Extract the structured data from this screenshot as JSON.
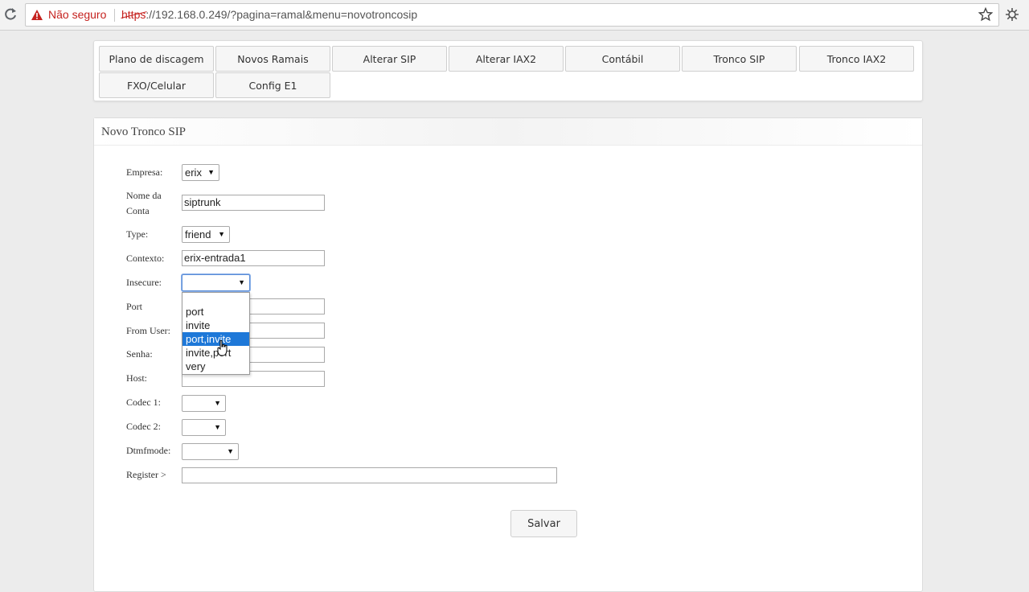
{
  "browser": {
    "security_label": "Não seguro",
    "url_scheme": "https",
    "url_rest": "://192.168.0.249/?pagina=ramal&menu=novotroncosip",
    "icons": [
      "reload-icon",
      "warning-icon",
      "star-icon",
      "extension-icon"
    ],
    "warning_color": "#c5221f"
  },
  "nav": {
    "buttons": [
      "Plano de discagem",
      "Novos Ramais",
      "Alterar SIP",
      "Alterar IAX2",
      "Contábil",
      "Tronco SIP",
      "Tronco IAX2",
      "FXO/Celular",
      "Config E1"
    ]
  },
  "form": {
    "title": "Novo Tronco SIP",
    "empresa": {
      "label": "Empresa:",
      "value": "erix"
    },
    "nome_conta": {
      "label_line1": "Nome da",
      "label_line2": "Conta",
      "value": "siptrunk"
    },
    "type": {
      "label": "Type:",
      "value": "friend"
    },
    "contexto": {
      "label": "Contexto:",
      "value": "erix-entrada1"
    },
    "insecure": {
      "label": "Insecure:",
      "value": "",
      "options": [
        "",
        "port",
        "invite",
        "port,invite",
        "invite,port",
        "very"
      ],
      "highlighted": "port,invite"
    },
    "port": {
      "label": "Port",
      "value": ""
    },
    "from_user": {
      "label": "From User:",
      "value": ""
    },
    "senha": {
      "label": "Senha:",
      "value": ""
    },
    "host": {
      "label": "Host:",
      "value": ""
    },
    "codec1": {
      "label": "Codec 1:",
      "value": ""
    },
    "codec2": {
      "label": "Codec 2:",
      "value": ""
    },
    "dtmfmode": {
      "label": "Dtmfmode:",
      "value": ""
    },
    "register": {
      "label": "Register >",
      "value": ""
    },
    "save_label": "Salvar"
  },
  "colors": {
    "highlight": "#1e78d8",
    "button_bg": "#f6f6f6"
  }
}
